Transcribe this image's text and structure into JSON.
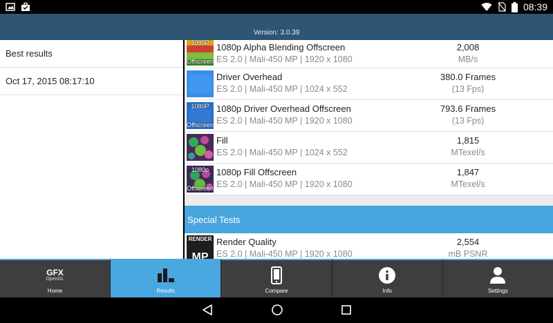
{
  "status_bar": {
    "time": "08:39",
    "icons_left": [
      "image-icon",
      "briefcase-icon"
    ],
    "icons_right": [
      "wifi-icon",
      "no-sim-icon",
      "battery-icon"
    ]
  },
  "header": {
    "version": "Version: 3.0.39"
  },
  "left_panel": {
    "items": [
      {
        "label": "Best results"
      },
      {
        "label": "Oct 17, 2015 08:17:10"
      }
    ]
  },
  "results": [
    {
      "title": "1080p Alpha Blending Offscreen",
      "sub": "ES 2.0 | Mali-450 MP | 1920 x 1080",
      "value": "2,008",
      "unit": "MB/s",
      "thumb_line1": "1080P",
      "thumb_line2": "Offscreen",
      "thumb": "alpha-blending"
    },
    {
      "title": "Driver Overhead",
      "sub": "ES 2.0 | Mali-450 MP | 1024 x 552",
      "value": "380.0 Frames",
      "unit": "(13 Fps)",
      "thumb_line1": "",
      "thumb_line2": "",
      "thumb": "driver-overhead"
    },
    {
      "title": "1080p Driver Overhead Offscreen",
      "sub": "ES 2.0 | Mali-450 MP | 1920 x 1080",
      "value": "793.6 Frames",
      "unit": "(13 Fps)",
      "thumb_line1": "1080P",
      "thumb_line2": "Offscreen",
      "thumb": "driver-overhead"
    },
    {
      "title": "Fill",
      "sub": "ES 2.0 | Mali-450 MP | 1024 x 552",
      "value": "1,815",
      "unit": "MTexel/s",
      "thumb_line1": "",
      "thumb_line2": "",
      "thumb": "fill"
    },
    {
      "title": "1080p Fill Offscreen",
      "sub": "ES 2.0 | Mali-450 MP | 1920 x 1080",
      "value": "1,847",
      "unit": "MTexel/s",
      "thumb_line1": "1080p",
      "thumb_line2": "Offscreen",
      "thumb": "fill"
    }
  ],
  "special_section": {
    "title": "Special Tests",
    "item": {
      "title": "Render Quality",
      "sub": "ES 2.0 | Mali-450 MP | 1920 x 1080",
      "value": "2,554",
      "unit": "mB PSNR",
      "thumb_line1": "RENDER",
      "thumb_line2": "MP"
    }
  },
  "bottom_nav": [
    {
      "label": "Home",
      "icon": "gfx-logo-icon",
      "logo_top": "GFX",
      "logo_bottom": "OpenGL",
      "active": false
    },
    {
      "label": "Results",
      "icon": "bar-chart-icon",
      "active": true
    },
    {
      "label": "Compare",
      "icon": "phone-icon",
      "active": false
    },
    {
      "label": "Info",
      "icon": "info-icon",
      "active": false
    },
    {
      "label": "Settings",
      "icon": "person-icon",
      "active": false
    }
  ],
  "colors": {
    "header": "#2e5574",
    "accent": "#4aa8e0",
    "section": "#49a5dd"
  }
}
